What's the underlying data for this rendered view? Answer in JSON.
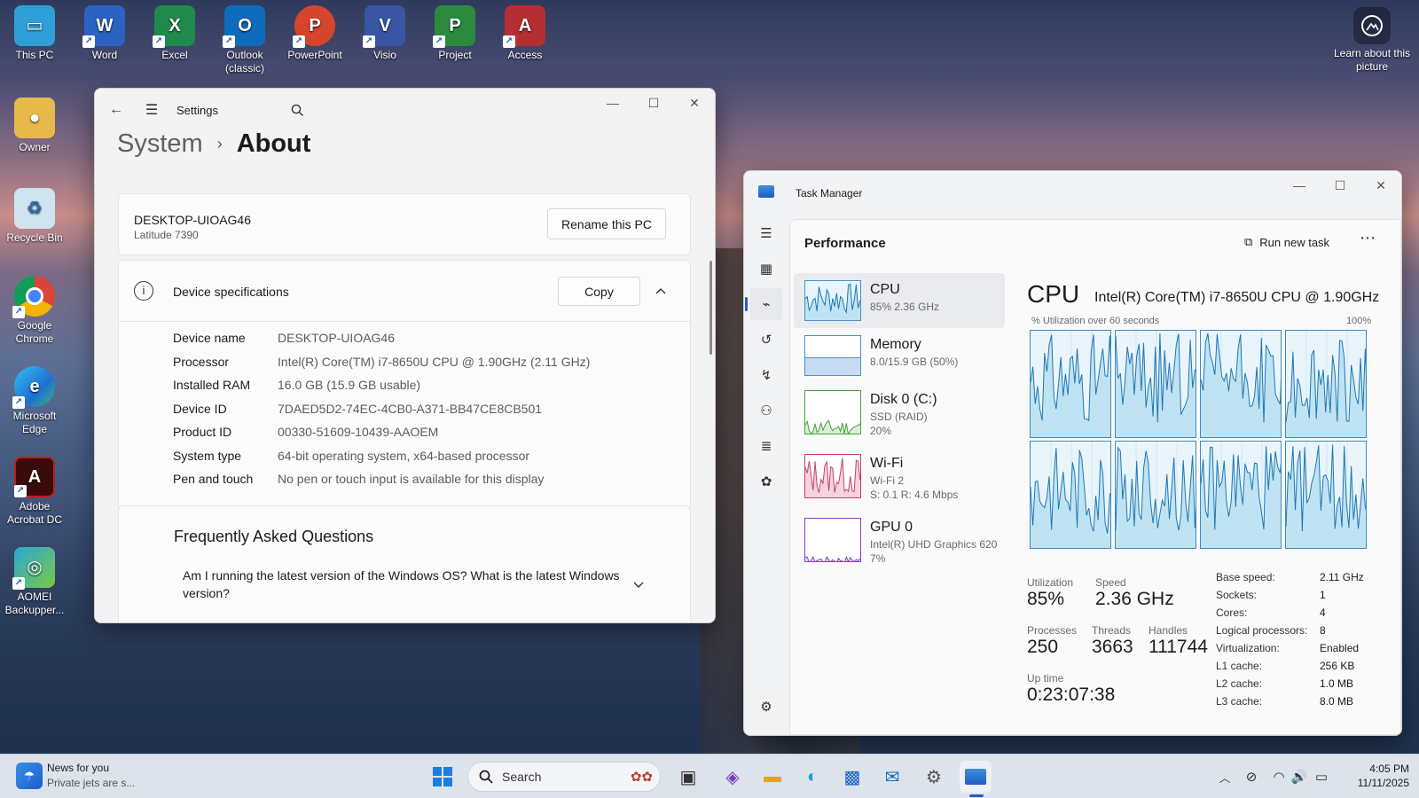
{
  "desktop": {
    "icons": [
      {
        "label": "This PC",
        "color": "#2f9fd8",
        "glyph": "▭"
      },
      {
        "label": "Word",
        "color": "#2b63c2",
        "glyph": "W"
      },
      {
        "label": "Excel",
        "color": "#1f8a4c",
        "glyph": "X"
      },
      {
        "label": "Outlook (classic)",
        "color": "#0f6cbd",
        "glyph": "O"
      },
      {
        "label": "PowerPoint",
        "color": "#d5452b",
        "glyph": "P"
      },
      {
        "label": "Visio",
        "color": "#3955a3",
        "glyph": "V"
      },
      {
        "label": "Project",
        "color": "#2b8a3e",
        "glyph": "P"
      },
      {
        "label": "Access",
        "color": "#b52e31",
        "glyph": "A"
      },
      {
        "label": "Owner",
        "color": "#e7b94a",
        "glyph": "●"
      },
      {
        "label": "Recycle Bin",
        "color": "#cfe3f1",
        "glyph": "♻"
      },
      {
        "label": "Google Chrome",
        "color": "#db4437",
        "glyph": "◉"
      },
      {
        "label": "Microsoft Edge",
        "color": "#1e9bd7",
        "glyph": "e"
      },
      {
        "label": "Adobe Acrobat DC",
        "color": "#3a0b0b",
        "glyph": "A"
      },
      {
        "label": "AOMEI Backupper...",
        "color": "#2aa7d8",
        "glyph": "◎"
      }
    ],
    "learn": {
      "label": "Learn about this picture",
      "icon": "camera-icon"
    }
  },
  "settings": {
    "app_title": "Settings",
    "breadcrumb_parent": "System",
    "breadcrumb_current": "About",
    "pc_name": "DESKTOP-UIOAG46",
    "pc_model": "Latitude 7390",
    "rename_button": "Rename this PC",
    "spec_title": "Device specifications",
    "copy_button": "Copy",
    "specs": [
      {
        "k": "Device name",
        "v": "DESKTOP-UIOAG46"
      },
      {
        "k": "Processor",
        "v": "Intel(R) Core(TM) i7-8650U CPU @ 1.90GHz (2.11 GHz)"
      },
      {
        "k": "Installed RAM",
        "v": "16.0 GB (15.9 GB usable)"
      },
      {
        "k": "Device ID",
        "v": "7DAED5D2-74EC-4CB0-A371-BB47CE8CB501"
      },
      {
        "k": "Product ID",
        "v": "00330-51609-10439-AAOEM"
      },
      {
        "k": "System type",
        "v": "64-bit operating system, x64-based processor"
      },
      {
        "k": "Pen and touch",
        "v": "No pen or touch input is available for this display"
      }
    ],
    "faq_title": "Frequently Asked Questions",
    "faq_q1": "Am I running the latest version of the Windows OS? What is the latest Windows version?"
  },
  "taskmanager": {
    "title": "Task Manager",
    "section": "Performance",
    "run_new_task": "Run new task",
    "items": [
      {
        "name": "CPU",
        "sub1": "85% 2.36 GHz",
        "sub2": "",
        "sub3": "",
        "color": "#3d8ac2"
      },
      {
        "name": "Memory",
        "sub1": "8.0/15.9 GB (50%)",
        "sub2": "",
        "sub3": "",
        "color": "#3d8ac2"
      },
      {
        "name": "Disk 0 (C:)",
        "sub1": "SSD (RAID)",
        "sub2": "20%",
        "sub3": "",
        "color": "#4aa043"
      },
      {
        "name": "Wi-Fi",
        "sub1": "Wi-Fi 2",
        "sub2": "S: 0.1  R: 4.6 Mbps",
        "sub3": "",
        "color": "#c4406a"
      },
      {
        "name": "GPU 0",
        "sub1": "Intel(R) UHD Graphics 620",
        "sub2": "7%",
        "sub3": "",
        "color": "#8b3fc4"
      }
    ],
    "cpu_heading": "CPU",
    "cpu_model": "Intel(R) Core(TM) i7-8650U CPU @ 1.90GHz",
    "util_label": "% Utilization over 60 seconds",
    "util_max": "100%",
    "stats": {
      "utilization_label": "Utilization",
      "utilization": "85%",
      "speed_label": "Speed",
      "speed": "2.36 GHz",
      "processes_label": "Processes",
      "processes": "250",
      "threads_label": "Threads",
      "threads": "3663",
      "handles_label": "Handles",
      "handles": "111744",
      "uptime_label": "Up time",
      "uptime": "0:23:07:38"
    },
    "details": [
      {
        "k": "Base speed:",
        "v": "2.11 GHz"
      },
      {
        "k": "Sockets:",
        "v": "1"
      },
      {
        "k": "Cores:",
        "v": "4"
      },
      {
        "k": "Logical processors:",
        "v": "8"
      },
      {
        "k": "Virtualization:",
        "v": "Enabled"
      },
      {
        "k": "L1 cache:",
        "v": "256 KB"
      },
      {
        "k": "L2 cache:",
        "v": "1.0 MB"
      },
      {
        "k": "L3 cache:",
        "v": "8.0 MB"
      }
    ]
  },
  "taskbar": {
    "news_title": "News for you",
    "news_sub": "Private jets are s...",
    "search_placeholder": "Search",
    "time": "4:05 PM",
    "date": "11/11/2025"
  }
}
